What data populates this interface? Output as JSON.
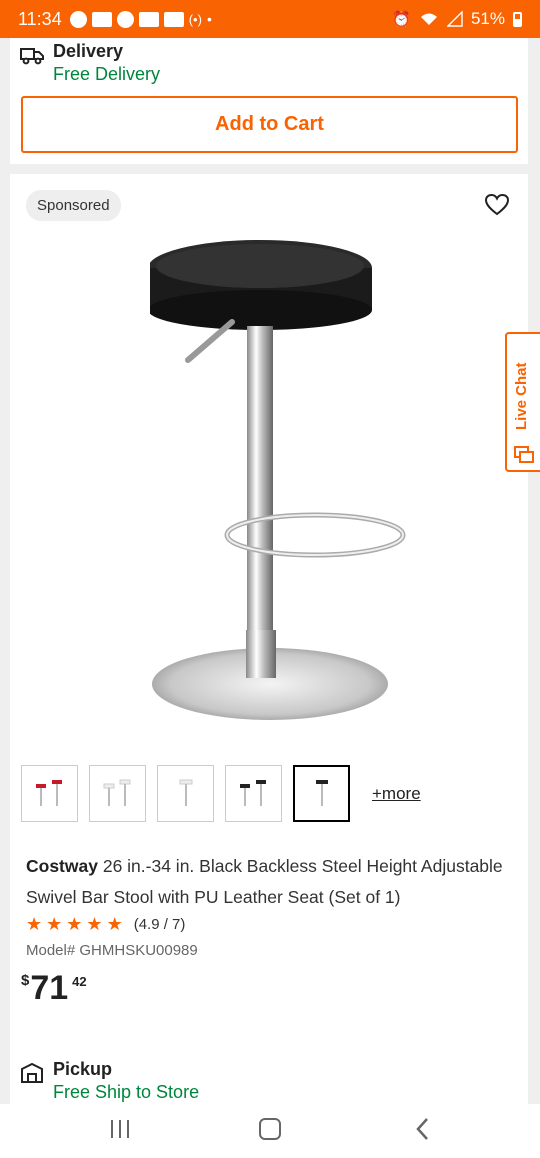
{
  "status_bar": {
    "time": "11:34",
    "battery": "51%"
  },
  "delivery": {
    "title": "Delivery",
    "subtitle": "Free Delivery",
    "icon": "delivery-truck-icon"
  },
  "add_to_cart": {
    "label": "Add to Cart"
  },
  "product": {
    "sponsored": "Sponsored",
    "brand": "Costway",
    "title": "26 in.-34 in. Black Backless Steel Height Adjustable Swivel Bar Stool with PU Leather Seat (Set of 1)",
    "rating_stars": 5,
    "rating_text": "(4.9 / 7)",
    "model": "Model# GHMHSKU00989",
    "price": {
      "currency": "$",
      "dollars": "71",
      "cents": "42"
    },
    "thumbnails": [
      {
        "alt": "red-stools"
      },
      {
        "alt": "white-stools"
      },
      {
        "alt": "white-stool-single"
      },
      {
        "alt": "black-stools"
      },
      {
        "alt": "black-stool-single",
        "selected": true
      }
    ],
    "more_label": "+more"
  },
  "pickup": {
    "title": "Pickup",
    "subtitle": "Free Ship to Store",
    "icon": "store-pickup-icon"
  },
  "live_chat": {
    "label": "Live Chat"
  },
  "colors": {
    "brand": "#f96302",
    "green": "#00853c"
  }
}
